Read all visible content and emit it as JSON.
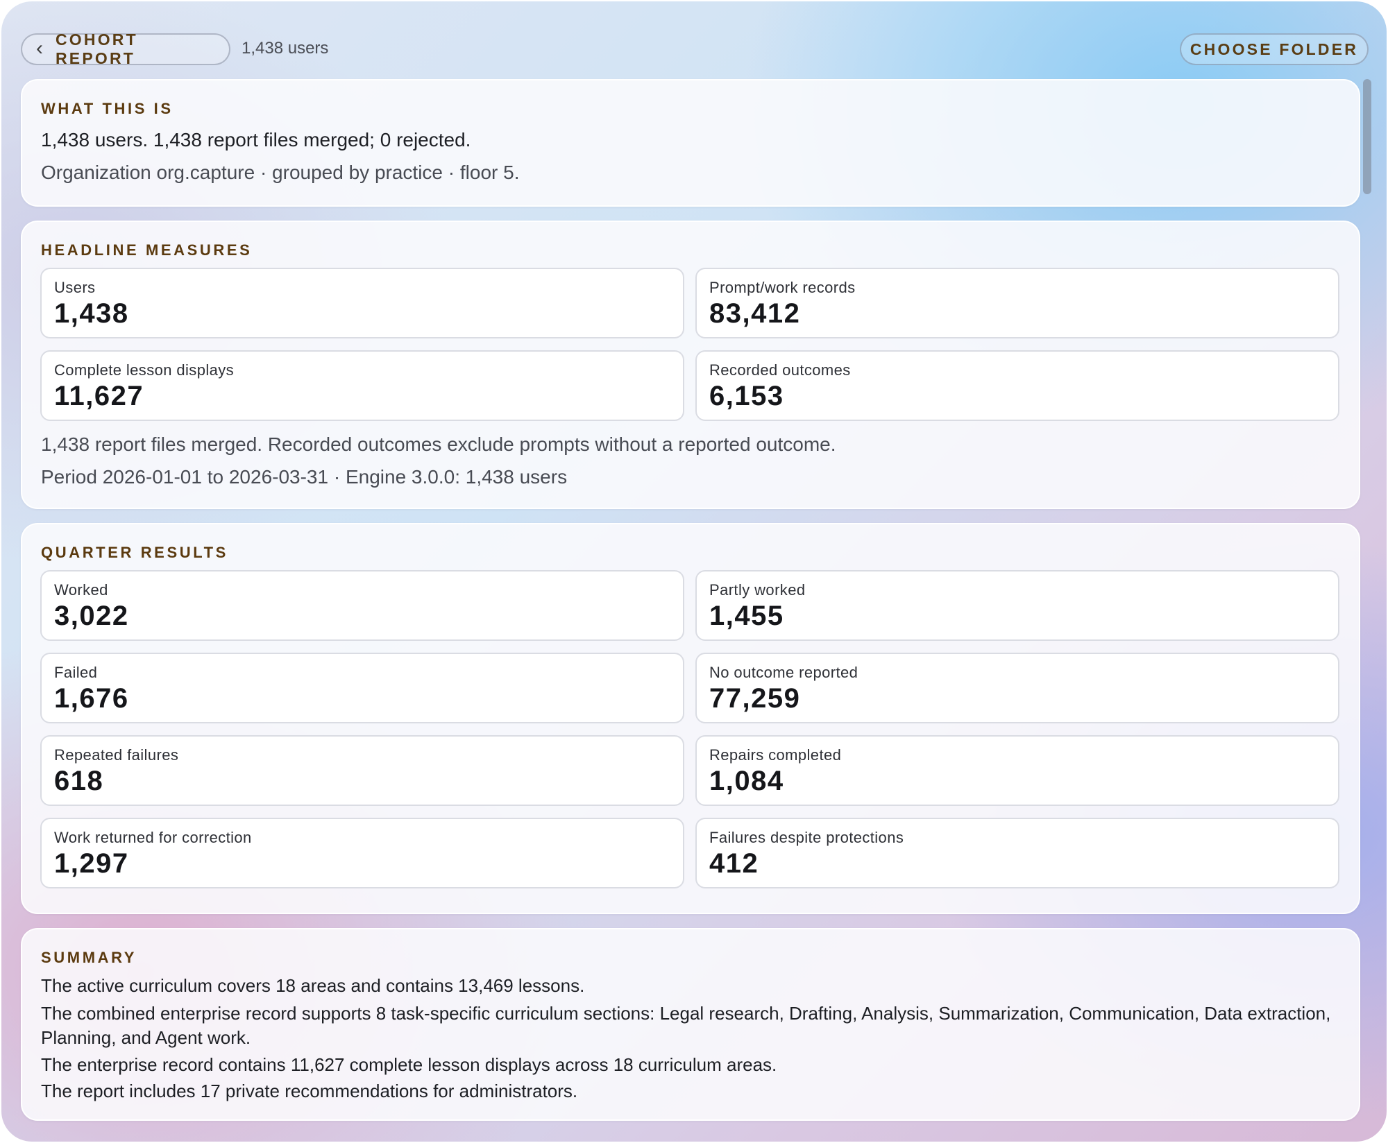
{
  "header": {
    "back_label": "COHORT REPORT",
    "user_count": "1,438 users",
    "choose_folder_label": "CHOOSE FOLDER"
  },
  "what_this_is": {
    "label": "WHAT THIS IS",
    "line1": "1,438 users. 1,438 report files merged; 0 rejected.",
    "line2": "Organization org.capture · grouped by practice · floor 5."
  },
  "headline": {
    "label": "HEADLINE MEASURES",
    "metrics": [
      {
        "label": "Users",
        "value": "1,438"
      },
      {
        "label": "Prompt/work records",
        "value": "83,412"
      },
      {
        "label": "Complete lesson displays",
        "value": "11,627"
      },
      {
        "label": "Recorded outcomes",
        "value": "6,153"
      }
    ],
    "note1": "1,438 report files merged. Recorded outcomes exclude prompts without a reported outcome.",
    "note2": "Period 2026-01-01 to 2026-03-31 · Engine 3.0.0: 1,438 users"
  },
  "quarter": {
    "label": "QUARTER RESULTS",
    "metrics": [
      {
        "label": "Worked",
        "value": "3,022"
      },
      {
        "label": "Partly worked",
        "value": "1,455"
      },
      {
        "label": "Failed",
        "value": "1,676"
      },
      {
        "label": "No outcome reported",
        "value": "77,259"
      },
      {
        "label": "Repeated failures",
        "value": "618"
      },
      {
        "label": "Repairs completed",
        "value": "1,084"
      },
      {
        "label": "Work returned for correction",
        "value": "1,297"
      },
      {
        "label": "Failures despite protections",
        "value": "412"
      }
    ]
  },
  "summary": {
    "label": "SUMMARY",
    "lines": [
      "The active curriculum covers 18 areas and contains 13,469 lessons.",
      "The combined enterprise record supports 8 task-specific curriculum sections: Legal research, Drafting, Analysis, Summarization, Communication, Data extraction, Planning, and Agent work.",
      "The enterprise record contains 11,627 complete lesson displays across 18 curriculum areas.",
      "The report includes 17 private recommendations for administrators."
    ]
  }
}
